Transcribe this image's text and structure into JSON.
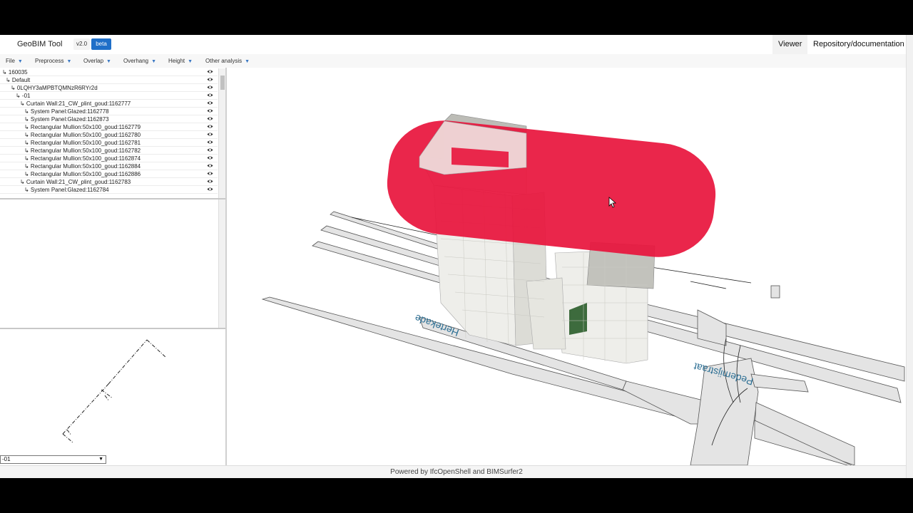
{
  "app": {
    "title": "GeoBIM Tool",
    "version": "v2.0",
    "badge": "beta"
  },
  "nav": {
    "viewer": "Viewer",
    "repository": "Repository/documentation"
  },
  "menu": {
    "items": [
      {
        "label": "File"
      },
      {
        "label": "Preprocess"
      },
      {
        "label": "Overlap"
      },
      {
        "label": "Overhang"
      },
      {
        "label": "Height"
      },
      {
        "label": "Other analysis"
      }
    ]
  },
  "tree": {
    "rows": [
      {
        "label": "↳ 160035"
      },
      {
        "label": "↳ Default"
      },
      {
        "label": "↳ 0LQHY3aMPBTQMNzR6RYr2d"
      },
      {
        "label": "↳ -01"
      },
      {
        "label": "↳ Curtain Wall:21_CW_plint_goud:1162777"
      },
      {
        "label": "↳ System Panel:Glazed:1162778"
      },
      {
        "label": "↳ System Panel:Glazed:1162873"
      },
      {
        "label": "↳ Rectangular Mullion:50x100_goud:1162779"
      },
      {
        "label": "↳ Rectangular Mullion:50x100_goud:1162780"
      },
      {
        "label": "↳ Rectangular Mullion:50x100_goud:1162781"
      },
      {
        "label": "↳ Rectangular Mullion:50x100_goud:1162782"
      },
      {
        "label": "↳ Rectangular Mullion:50x100_goud:1162874"
      },
      {
        "label": "↳ Rectangular Mullion:50x100_goud:1162884"
      },
      {
        "label": "↳ Rectangular Mullion:50x100_goud:1162886"
      },
      {
        "label": "↳ Curtain Wall:21_CW_plint_goud:1162783"
      },
      {
        "label": "↳ System Panel:Glazed:1162784"
      }
    ]
  },
  "storey_select": {
    "value": "-01"
  },
  "viewer": {
    "street_labels": [
      "Hertekade",
      "Pedemijstraat"
    ],
    "overlap_color": "#e8143c",
    "ground_color": "#e4e4e4",
    "building_color": "#eeeeea"
  },
  "footer": {
    "text": "Powered by IfcOpenShell and BIMSurfer2"
  },
  "icons": {
    "visibility": "eye-icon",
    "dropdown": "chevron-down-icon",
    "cursor": "mouse-cursor-icon"
  }
}
